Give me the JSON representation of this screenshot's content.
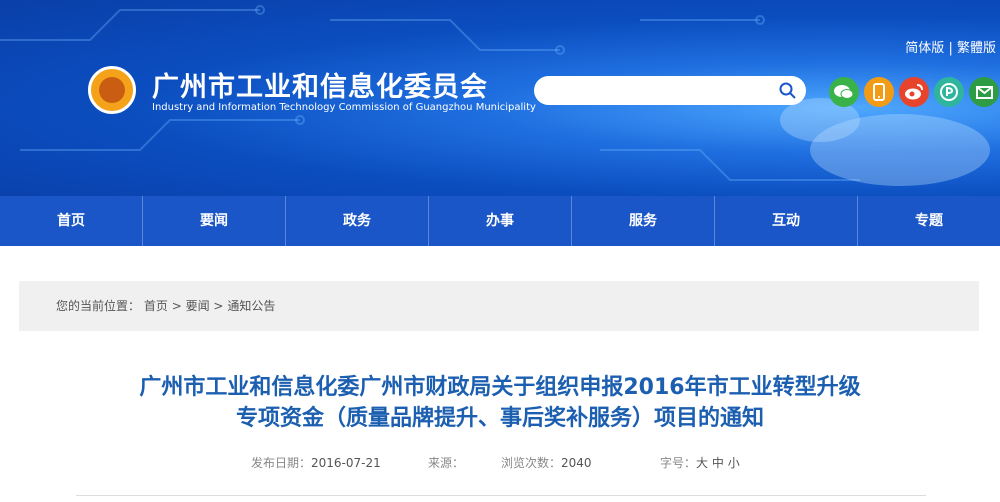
{
  "header": {
    "lang_simplified": "简体版",
    "lang_separator": "|",
    "lang_traditional": "繁體版",
    "title": "广州市工业和信息化委员会",
    "subtitle": "Industry and Information Technology Commission of Guangzhou Municipality",
    "search_placeholder": "",
    "social": [
      {
        "name": "wechat-icon",
        "color": "#3ab24a"
      },
      {
        "name": "mobile-icon",
        "color": "#f29b16"
      },
      {
        "name": "weibo-icon",
        "color": "#e8442b"
      },
      {
        "name": "share-icon",
        "color": "#2fb59d"
      },
      {
        "name": "mail-icon",
        "color": "#2e9b45"
      }
    ]
  },
  "nav": {
    "items": [
      "首页",
      "要闻",
      "政务",
      "办事",
      "服务",
      "互动",
      "专题"
    ]
  },
  "breadcrumb": {
    "prefix": "您的当前位置：",
    "items": [
      "首页",
      "要闻",
      "通知公告"
    ],
    "separator": ">"
  },
  "article": {
    "title_line1": "广州市工业和信息化委广州市财政局关于组织申报2016年市工业转型升级",
    "title_line2": "专项资金（质量品牌提升、事后奖补服务）项目的通知",
    "date_label": "发布日期：",
    "date": "2016-07-21",
    "source_label": "来源：",
    "source": "",
    "views_label": "浏览次数：",
    "views": "2040",
    "font_label": "字号：",
    "font_large": "大",
    "font_medium": "中",
    "font_small": "小"
  }
}
